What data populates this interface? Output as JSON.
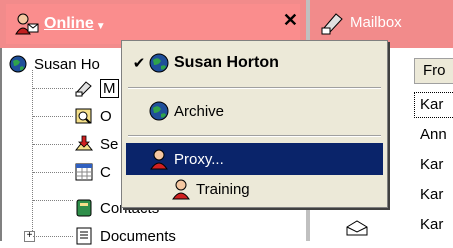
{
  "header": {
    "online_label": "Online",
    "mailbox_label": "Mailbox"
  },
  "tree": {
    "root_label": "Susan Ho",
    "items": [
      {
        "label": "M",
        "icon": "mailbox-icon"
      },
      {
        "label": "O",
        "icon": "search-folder-icon"
      },
      {
        "label": "Se",
        "icon": "sent-items-icon"
      },
      {
        "label": "C",
        "icon": "calendar-icon"
      },
      {
        "label": "Contacts",
        "icon": "contacts-icon"
      },
      {
        "label": "Documents",
        "icon": "documents-icon"
      }
    ]
  },
  "menu": {
    "items": [
      {
        "label": "Susan Horton",
        "checked": true,
        "bold": true
      },
      {
        "label": "Archive",
        "checked": false
      },
      {
        "label": "Proxy...",
        "highlighted": true
      },
      {
        "label": "Training",
        "indented": true
      }
    ]
  },
  "list": {
    "column_header": "Fro",
    "rows": [
      "Kar",
      "Ann",
      "Kar",
      "Kar",
      "Kar"
    ]
  },
  "colors": {
    "header_bg": "#f28b8b",
    "menu_bg": "#ece9d8",
    "highlight": "#0a246a"
  }
}
